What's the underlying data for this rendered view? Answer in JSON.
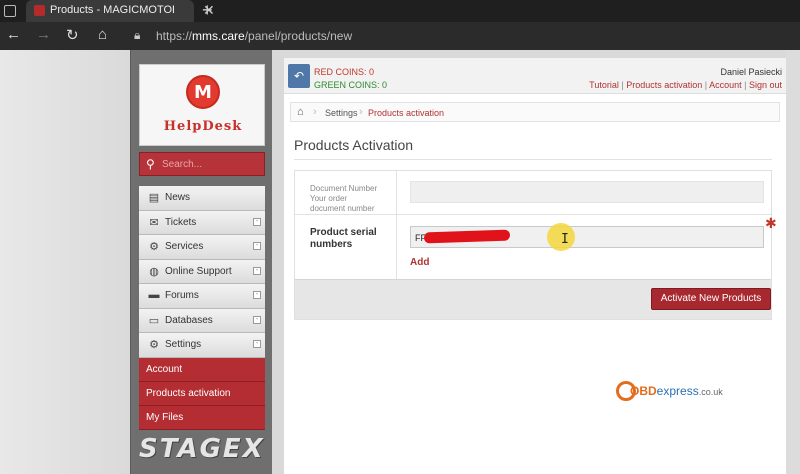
{
  "browser": {
    "tab_title": "Products - MAGICMOTORSPORT",
    "tab_close": "✕",
    "new_tab": "+",
    "url_prefix": "https://",
    "url_domain": "mms.care",
    "url_path": "/panel/products/new"
  },
  "sidebar": {
    "logo_text": "HelpDesk",
    "search_placeholder": "Search...",
    "menu": [
      {
        "label": "News",
        "icon": "rss-icon",
        "expand": false
      },
      {
        "label": "Tickets",
        "icon": "envelope-icon",
        "expand": true
      },
      {
        "label": "Services",
        "icon": "gear-icon",
        "expand": true
      },
      {
        "label": "Online Support",
        "icon": "globe-icon",
        "expand": true
      },
      {
        "label": "Forums",
        "icon": "chat-icon",
        "expand": true
      },
      {
        "label": "Databases",
        "icon": "folder-icon",
        "expand": true
      },
      {
        "label": "Settings",
        "icon": "gear-icon",
        "expand": true
      }
    ],
    "submenu": [
      {
        "label": "Account"
      },
      {
        "label": "Products activation"
      },
      {
        "label": "My Files"
      }
    ],
    "brand_footer": "STAGEX"
  },
  "topbar": {
    "red_coins": "RED COINS: 0",
    "green_coins": "GREEN COINS: 0",
    "user_name": "Daniel Pasiecki",
    "links": [
      "Tutorial",
      "Products activation",
      "Account",
      "Sign out"
    ]
  },
  "breadcrumb": {
    "settings": "Settings",
    "current": "Products activation"
  },
  "page": {
    "title": "Products Activation",
    "doc_label_1": "Document Number",
    "doc_label_2": "Your order",
    "doc_label_3": "document number",
    "doc_value": "",
    "serial_label_1": "Product serial",
    "serial_label_2": "numbers",
    "serial_value": "FF9",
    "add_link": "Add",
    "activate_button": "Activate New Products"
  },
  "watermark": {
    "obd": "OBD",
    "express": "express",
    "domain": ".co.uk"
  },
  "colors": {
    "accent_red": "#a8282f",
    "link_red": "#b03232",
    "green": "#2e8b2e"
  }
}
